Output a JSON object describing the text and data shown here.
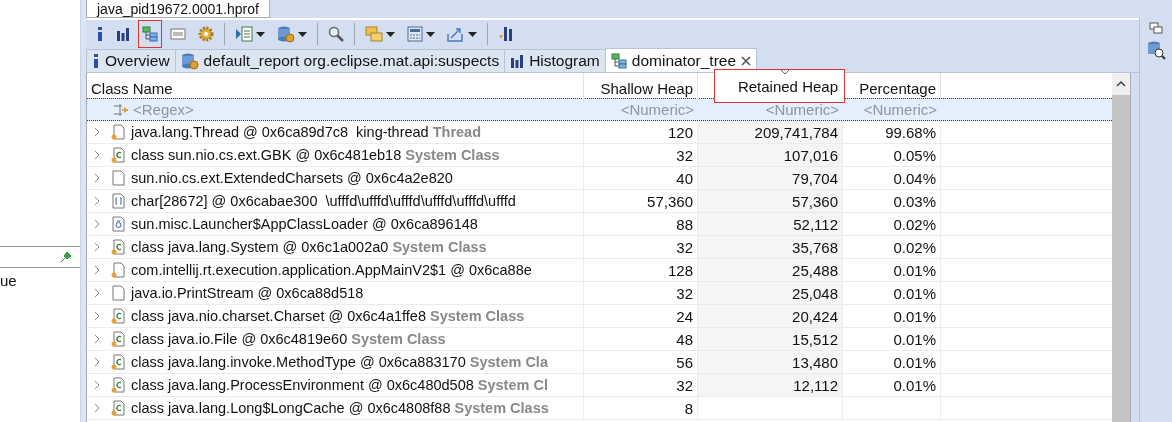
{
  "editor_tab": {
    "title": "java_pid19672.0001.hprof"
  },
  "left_panel": {
    "text": "ue"
  },
  "toolbar": [
    {
      "kind": "info",
      "dropdown": false,
      "highlighted": false
    },
    {
      "kind": "histogram",
      "dropdown": false,
      "highlighted": false
    },
    {
      "kind": "tree",
      "dropdown": false,
      "highlighted": true
    },
    {
      "kind": "oql",
      "dropdown": false,
      "highlighted": false
    },
    {
      "kind": "gear",
      "dropdown": false,
      "highlighted": false
    },
    {
      "kind": "sep"
    },
    {
      "kind": "list",
      "dropdown": true,
      "highlighted": false
    },
    {
      "kind": "database",
      "dropdown": true,
      "highlighted": false
    },
    {
      "kind": "sep"
    },
    {
      "kind": "search",
      "dropdown": false,
      "highlighted": false
    },
    {
      "kind": "sep"
    },
    {
      "kind": "group",
      "dropdown": true,
      "highlighted": false
    },
    {
      "kind": "calculator",
      "dropdown": true,
      "highlighted": false
    },
    {
      "kind": "export",
      "dropdown": true,
      "highlighted": false
    },
    {
      "kind": "sep"
    },
    {
      "kind": "chart",
      "dropdown": false,
      "highlighted": false
    }
  ],
  "tabs": [
    {
      "label": "Overview",
      "kind": "info",
      "selected": false,
      "closable": false
    },
    {
      "label": "default_report  org.eclipse.mat.api:suspects",
      "kind": "database",
      "selected": false,
      "closable": false
    },
    {
      "label": "Histogram",
      "kind": "histogram",
      "selected": false,
      "closable": false
    },
    {
      "label": "dominator_tree",
      "kind": "tree",
      "selected": true,
      "closable": true
    }
  ],
  "table": {
    "columns": [
      {
        "label": "Class Name",
        "filter": "<Regex>",
        "sorted": false,
        "highlighted": false
      },
      {
        "label": "Shallow Heap",
        "filter": "<Numeric>",
        "sorted": false,
        "highlighted": false
      },
      {
        "label": "Retained Heap",
        "filter": "<Numeric>",
        "sorted": true,
        "highlighted": true
      },
      {
        "label": "Percentage",
        "filter": "<Numeric>",
        "sorted": false,
        "highlighted": false
      }
    ],
    "rows": [
      {
        "kind": "object",
        "name": "java.lang.Thread @ 0x6ca89d7c8  king-thread",
        "tag": "Thread",
        "shallow": "120",
        "retained": "209,741,784",
        "percentage": "99.68%"
      },
      {
        "kind": "class",
        "name": "class sun.nio.cs.ext.GBK @ 0x6c481eb18",
        "tag": "System Class",
        "shallow": "32",
        "retained": "107,016",
        "percentage": "0.05%"
      },
      {
        "kind": "plain",
        "name": "sun.nio.cs.ext.ExtendedCharsets @ 0x6c4a2e820",
        "shallow": "40",
        "retained": "79,704",
        "percentage": "0.04%"
      },
      {
        "kind": "array",
        "name": "char[28672] @ 0x6cabae300  \\ufffd\\ufffd\\ufffd\\ufffd\\ufffd\\ufffd",
        "shallow": "57,360",
        "retained": "57,360",
        "percentage": "0.03%"
      },
      {
        "kind": "loader",
        "name": "sun.misc.Launcher$AppClassLoader @ 0x6ca896148",
        "shallow": "88",
        "retained": "52,112",
        "percentage": "0.02%"
      },
      {
        "kind": "class",
        "name": "class java.lang.System @ 0x6c1a002a0",
        "tag": "System Class",
        "shallow": "32",
        "retained": "35,768",
        "percentage": "0.02%"
      },
      {
        "kind": "object",
        "name": "com.intellij.rt.execution.application.AppMainV2$1 @ 0x6ca88e",
        "shallow": "128",
        "retained": "25,488",
        "percentage": "0.01%"
      },
      {
        "kind": "plain",
        "name": "java.io.PrintStream @ 0x6ca88d518",
        "shallow": "32",
        "retained": "25,048",
        "percentage": "0.01%"
      },
      {
        "kind": "class",
        "name": "class java.nio.charset.Charset @ 0x6c4a1ffe8",
        "tag": "System Class",
        "shallow": "24",
        "retained": "20,424",
        "percentage": "0.01%"
      },
      {
        "kind": "class",
        "name": "class java.io.File @ 0x6c4819e60",
        "tag": "System Class",
        "shallow": "48",
        "retained": "15,512",
        "percentage": "0.01%"
      },
      {
        "kind": "class",
        "name": "class java.lang.invoke.MethodType @ 0x6ca883170",
        "tag": "System Cla",
        "shallow": "56",
        "retained": "13,480",
        "percentage": "0.01%"
      },
      {
        "kind": "class",
        "name": "class java.lang.ProcessEnvironment @ 0x6c480d508",
        "tag": "System Cl",
        "shallow": "32",
        "retained": "12,112",
        "percentage": "0.01%"
      },
      {
        "kind": "class",
        "name": "class java.lang.Long$LongCache @ 0x6c4808f88",
        "tag": "System Class",
        "shallow": "8"
      }
    ]
  }
}
